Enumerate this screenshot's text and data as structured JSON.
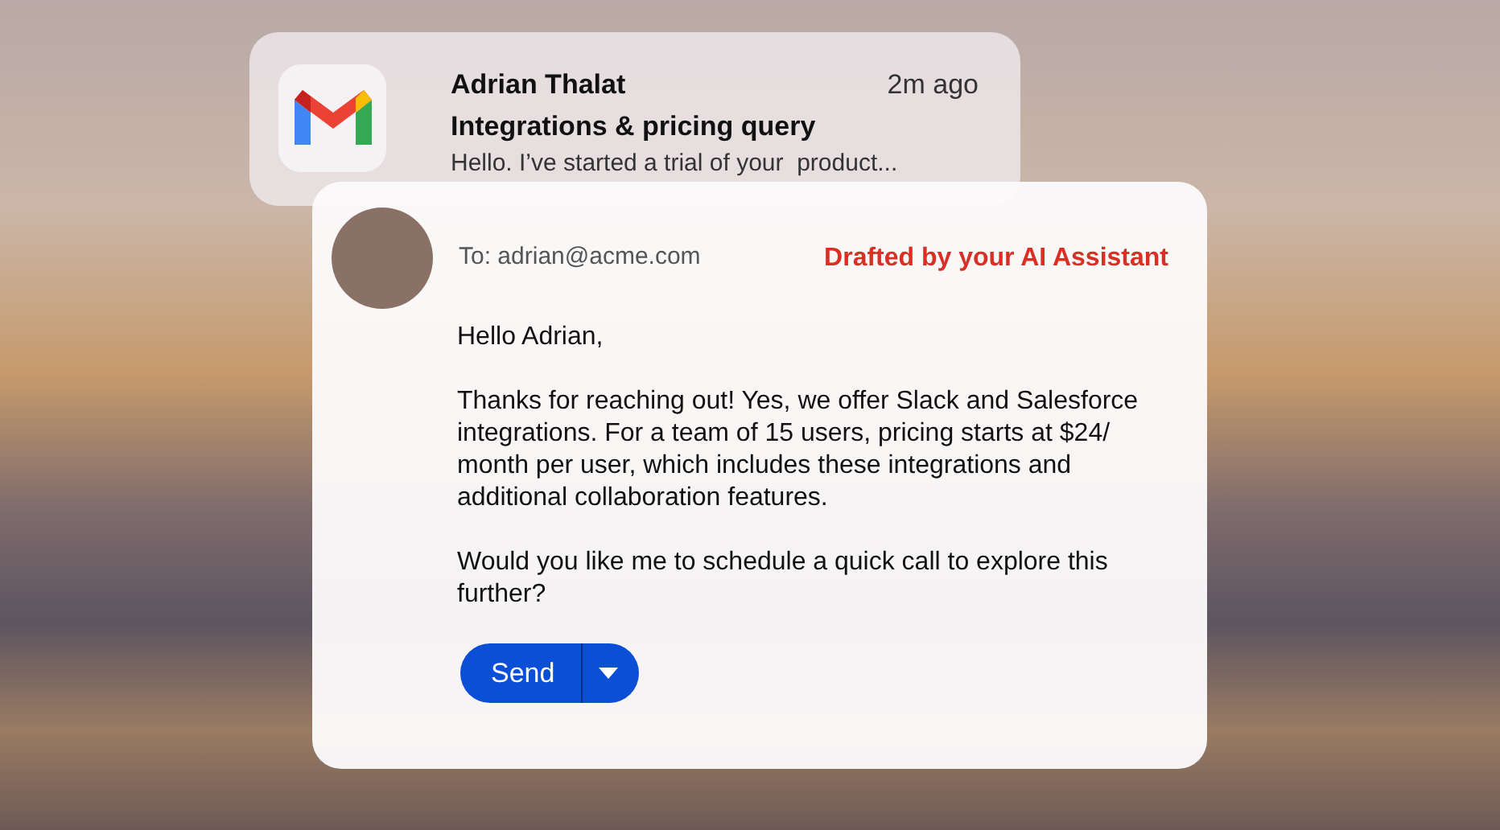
{
  "notification": {
    "sender": "Adrian Thalat",
    "time": "2m ago",
    "subject": "Integrations & pricing query",
    "preview": "Hello. I’ve started a trial of your  product..."
  },
  "draft": {
    "to": "To: adrian@acme.com",
    "label": "Drafted by your AI Assistant",
    "paragraphs": [
      "Hello Adrian,",
      "Thanks for reaching out! Yes, we offer Slack and Salesforce integrations. For a team of 15 users, pricing starts at $24/ month per user, which includes these integrations and additional collaboration features.",
      "Would you like me to schedule a quick call to explore this further?"
    ],
    "send_button": "Send"
  }
}
